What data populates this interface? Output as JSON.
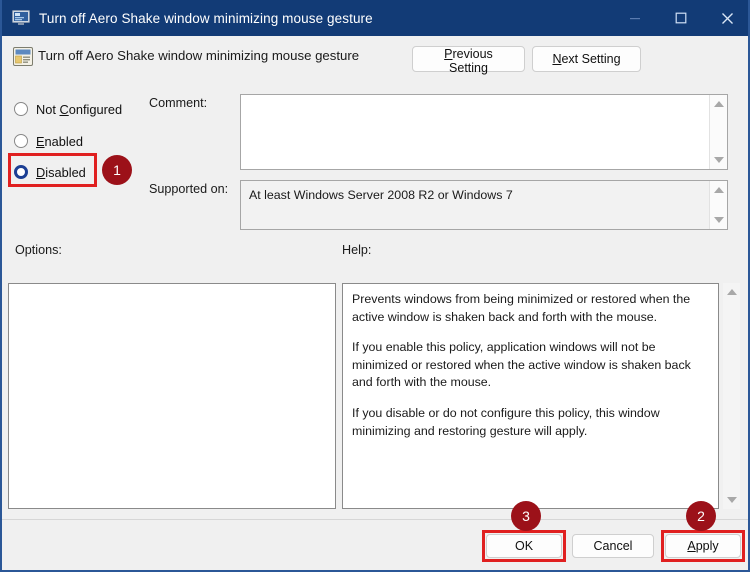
{
  "window": {
    "title": "Turn off Aero Shake window minimizing mouse gesture",
    "title_icon": "policy-setting-icon",
    "controls": {
      "minimize": "minimize-icon",
      "maximize": "maximize-icon",
      "close": "close-icon"
    }
  },
  "header": {
    "icon": "policy-setting-icon",
    "policy_name": "Turn off Aero Shake window minimizing mouse gesture",
    "previous_setting": {
      "prefix": "P",
      "rest": "revious Setting"
    },
    "next_setting": {
      "prefix": "N",
      "rest": "ext Setting"
    }
  },
  "state_options": [
    {
      "label_prefix": "Not ",
      "label_accel": "C",
      "label_rest": "onfigured",
      "selected": false
    },
    {
      "label_prefix": "",
      "label_accel": "E",
      "label_rest": "nabled",
      "selected": false
    },
    {
      "label_prefix": "",
      "label_accel": "D",
      "label_rest": "isabled",
      "selected": true
    }
  ],
  "fields": {
    "comment_label": "Comment:",
    "comment_value": "",
    "supported_label": "Supported on:",
    "supported_value": "At least Windows Server 2008 R2 or Windows 7"
  },
  "sections": {
    "options_label": "Options:",
    "help_label": "Help:"
  },
  "options_panel": {
    "content": ""
  },
  "help_text": [
    "Prevents windows from being minimized or restored when the active window is shaken back and forth with the mouse.",
    "If you enable this policy, application windows will not be minimized or restored when the active window is shaken back and forth with the mouse.",
    "If you disable or do not configure this policy, this window minimizing and restoring gesture will apply."
  ],
  "footer": {
    "ok": "OK",
    "cancel": "Cancel",
    "apply": {
      "prefix": "A",
      "rest": "pply"
    }
  },
  "annotations": {
    "badges": [
      {
        "number": "1",
        "target": "disabled-radio"
      },
      {
        "number": "2",
        "target": "apply-button"
      },
      {
        "number": "3",
        "target": "ok-button"
      }
    ],
    "highlight_color": "#e02020",
    "badge_color": "#9c1119"
  },
  "colors": {
    "titlebar": "#123b76",
    "window_background": "#f0f0f0",
    "accent_border": "#2b5797",
    "radio_selected": "#1c3f94"
  }
}
